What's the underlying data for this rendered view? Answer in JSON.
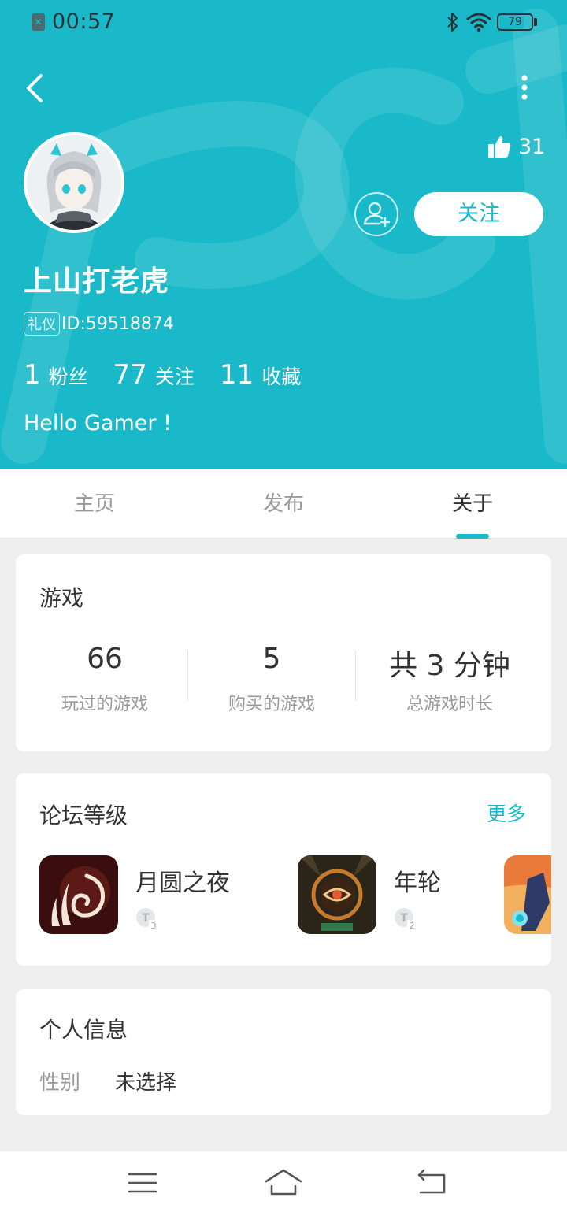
{
  "status_bar": {
    "time": "00:57",
    "battery": "79",
    "battery_level": 0.79
  },
  "profile": {
    "likes": "31",
    "follow_label": "关注",
    "username": "上山打老虎",
    "etiquette_badge": "礼仪",
    "user_id": "ID:59518874",
    "stats": [
      {
        "value": "1",
        "label": "粉丝"
      },
      {
        "value": "77",
        "label": "关注"
      },
      {
        "value": "11",
        "label": "收藏"
      }
    ],
    "bio": "Hello Gamer !"
  },
  "tabs": [
    "主页",
    "发布",
    "关于"
  ],
  "active_tab": "关于",
  "games": {
    "title": "游戏",
    "stats": [
      {
        "value": "66",
        "label": "玩过的游戏"
      },
      {
        "value": "5",
        "label": "购买的游戏"
      },
      {
        "value": "共 3 分钟",
        "label": "总游戏时长"
      }
    ]
  },
  "forum": {
    "title": "论坛等级",
    "more": "更多",
    "items": [
      {
        "name": "月圆之夜",
        "level": "3"
      },
      {
        "name": "年轮",
        "level": "2"
      }
    ]
  },
  "personal_info": {
    "title": "个人信息",
    "rows": [
      {
        "label": "性别",
        "value": "未选择"
      }
    ]
  },
  "colors": {
    "accent": "#1ab9c9",
    "text": "#333333",
    "muted": "#9a9a9a",
    "background": "#efefef"
  },
  "icons": [
    "back-arrow-icon",
    "more-vertical-icon",
    "thumbs-up-icon",
    "add-friend-icon",
    "menu-icon",
    "home-icon",
    "return-icon"
  ]
}
